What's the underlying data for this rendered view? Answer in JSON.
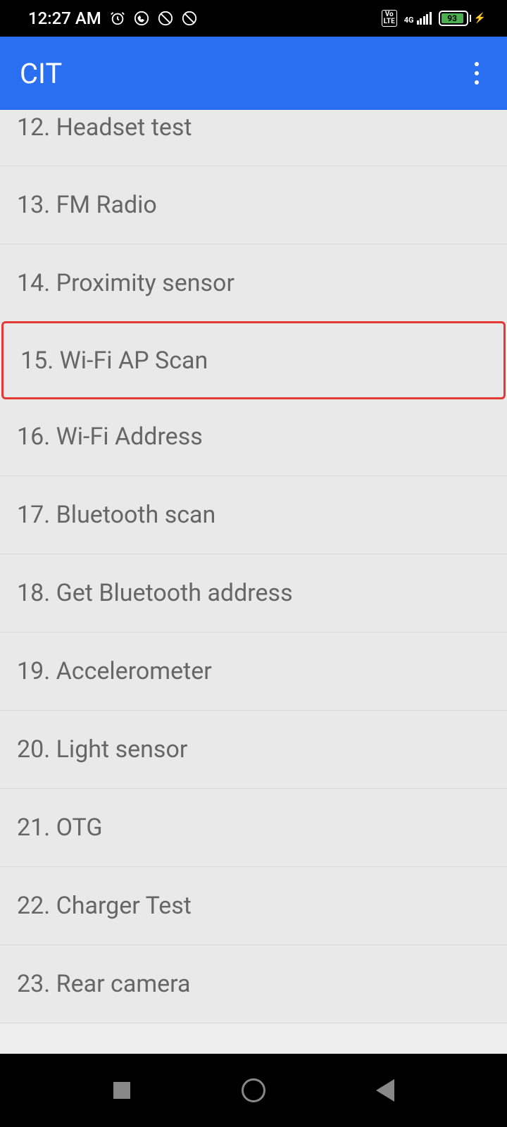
{
  "status": {
    "time": "12:27 AM",
    "battery_percent": "93",
    "network_type": "4G",
    "volte": "Vo\nLTE"
  },
  "header": {
    "title": "CIT"
  },
  "list": {
    "items": [
      {
        "label": "12. Headset test",
        "highlighted": false,
        "first": true
      },
      {
        "label": "13. FM Radio",
        "highlighted": false
      },
      {
        "label": "14. Proximity sensor",
        "highlighted": false
      },
      {
        "label": "15. Wi-Fi AP Scan",
        "highlighted": true
      },
      {
        "label": "16. Wi-Fi Address",
        "highlighted": false
      },
      {
        "label": "17. Bluetooth scan",
        "highlighted": false
      },
      {
        "label": "18. Get Bluetooth address",
        "highlighted": false
      },
      {
        "label": "19. Accelerometer",
        "highlighted": false
      },
      {
        "label": "20. Light sensor",
        "highlighted": false
      },
      {
        "label": "21. OTG",
        "highlighted": false
      },
      {
        "label": "22. Charger Test",
        "highlighted": false
      },
      {
        "label": "23. Rear camera",
        "highlighted": false
      }
    ]
  }
}
